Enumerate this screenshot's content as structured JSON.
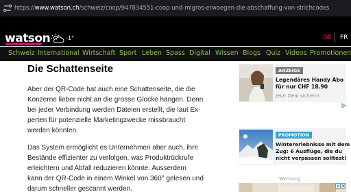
{
  "browser": {
    "url_prefix": "https://",
    "url_host": "www.watson.ch",
    "url_path": "/schweiz/coop/947834551-coop-und-migros-erwaegen-die-abschaffung-von-strichcodes"
  },
  "header": {
    "logo": "watson",
    "temperature": "-1°",
    "lang_de": "DE",
    "lang_fr": "FR"
  },
  "nav": {
    "items": [
      "Schweiz",
      "International",
      "Wirtschaft",
      "Sport",
      "Leben",
      "Spass",
      "Digital",
      "Wissen",
      "Blogs",
      "Quiz",
      "Videos",
      "Promotionen"
    ]
  },
  "article": {
    "heading": "Die Schattenseite",
    "para1": [
      "Aber der QR-Code hat auch eine Schattenseite, die die",
      "Konzerne lieber nicht an die grosse Glocke hängen. Denn",
      "bei jeder Verbindung werden Dateien erstellt, die laut Ex-",
      "perten für potenzielle Marketingzwecke missbraucht",
      "werden könnten."
    ],
    "para2": [
      "Das System ermöglicht es Unternehmen aber auch, ihre",
      "Bestände effizienter zu verfolgen, was Produktrückrufe",
      "erleichtern und Abfall reduzieren könnte. Ausserdem",
      "kann der QR-Code in einem Winkel von 360° gelesen und",
      "darum schneller gescannt werden."
    ]
  },
  "ads": {
    "ad1": {
      "tag": "ANZEIGE",
      "title_line1": "Legendäres Handy Abo",
      "title_line2": "für nur CHF 18.90",
      "subtitle": "Jetzt Deal sichern!"
    },
    "ad2": {
      "tag": "PROMOTION",
      "title_line1": "Wintererlebnisse mit dem",
      "title_line2": "Zug: 6 Ausflüge, die du",
      "title_line3": "nicht verpassen solltest!"
    },
    "werbung_label": "Werbung"
  },
  "colors": {
    "accent_pink": "#e6007e",
    "nav_green": "#8cc63f",
    "promo_blue": "#2aa8e0"
  }
}
